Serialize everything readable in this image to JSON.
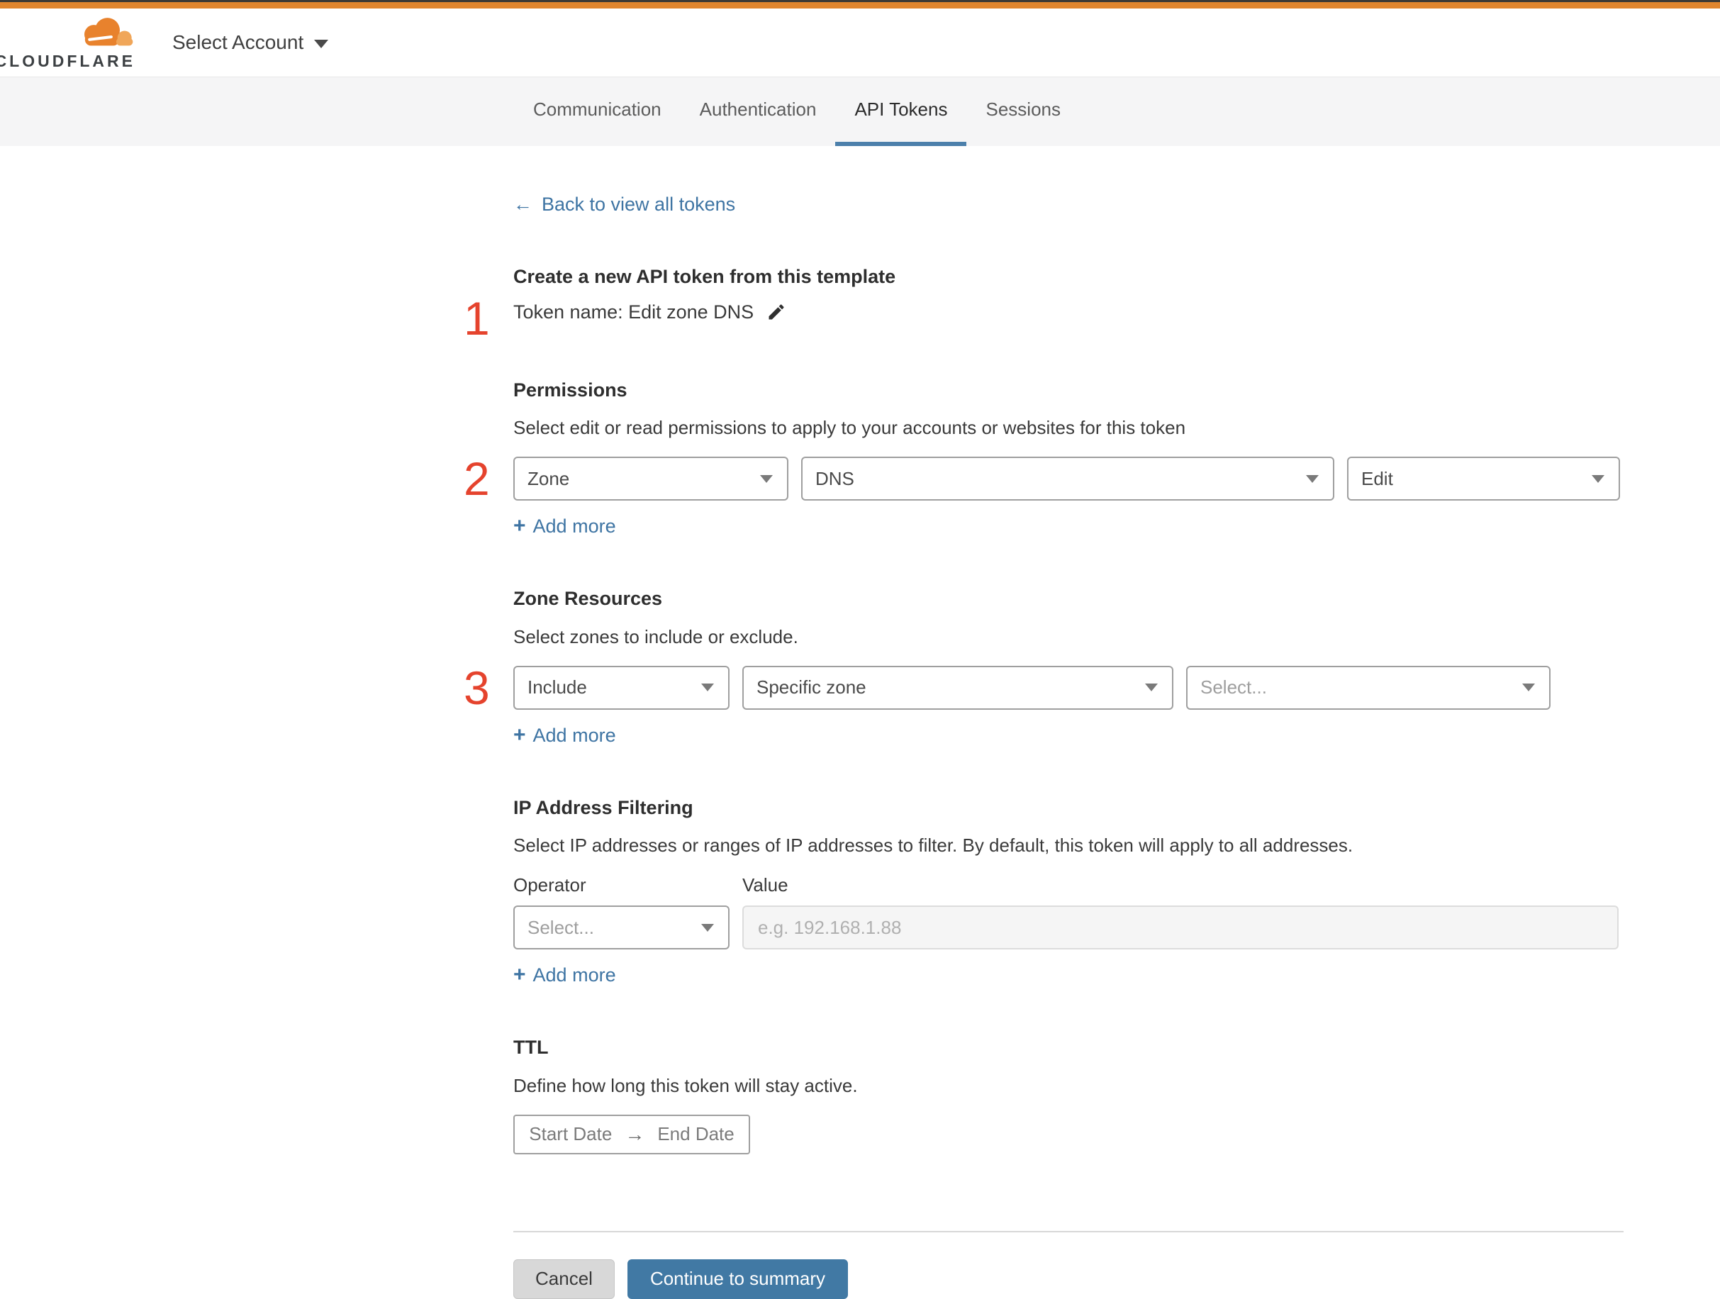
{
  "header": {
    "logo_wordmark": "CLOUDFLARE",
    "account_selector_label": "Select Account"
  },
  "tabs": {
    "items": [
      {
        "label": "Communication",
        "active": false
      },
      {
        "label": "Authentication",
        "active": false
      },
      {
        "label": "API Tokens",
        "active": true
      },
      {
        "label": "Sessions",
        "active": false
      }
    ]
  },
  "back_link": {
    "arrow": "←",
    "label": "Back to view all tokens"
  },
  "intro": {
    "marker": "1",
    "title": "Create a new API token from this template",
    "token_name_line": "Token name: Edit zone DNS"
  },
  "permissions": {
    "marker": "2",
    "title": "Permissions",
    "description": "Select edit or read permissions to apply to your accounts or websites for this token",
    "scope_select_value": "Zone",
    "service_select_value": "DNS",
    "access_select_value": "Edit",
    "add_more": {
      "plus": "+",
      "label": "Add more"
    }
  },
  "zone_resources": {
    "marker": "3",
    "title": "Zone Resources",
    "description": "Select zones to include or exclude.",
    "mode_select_value": "Include",
    "type_select_value": "Specific zone",
    "zone_select_placeholder": "Select...",
    "add_more": {
      "plus": "+",
      "label": "Add more"
    }
  },
  "ip_filtering": {
    "title": "IP Address Filtering",
    "description": "Select IP addresses or ranges of IP addresses to filter. By default, this token will apply to all addresses.",
    "operator_label": "Operator",
    "value_label": "Value",
    "operator_select_placeholder": "Select...",
    "value_placeholder": "e.g. 192.168.1.88",
    "add_more": {
      "plus": "+",
      "label": "Add more"
    }
  },
  "ttl": {
    "title": "TTL",
    "description": "Define how long this token will stay active.",
    "start_date": "Start Date",
    "arrow": "→",
    "end_date": "End Date"
  },
  "footer": {
    "cancel": "Cancel",
    "continue": "Continue to summary"
  },
  "colors": {
    "top_bar_orange": "#e0862e",
    "link_blue": "#3e74a3",
    "marker_red": "#e5432d",
    "continue_button_blue": "#4179a4",
    "tab_underline_blue": "#4c80ab",
    "tab_strip_gray": "#f5f5f6"
  }
}
